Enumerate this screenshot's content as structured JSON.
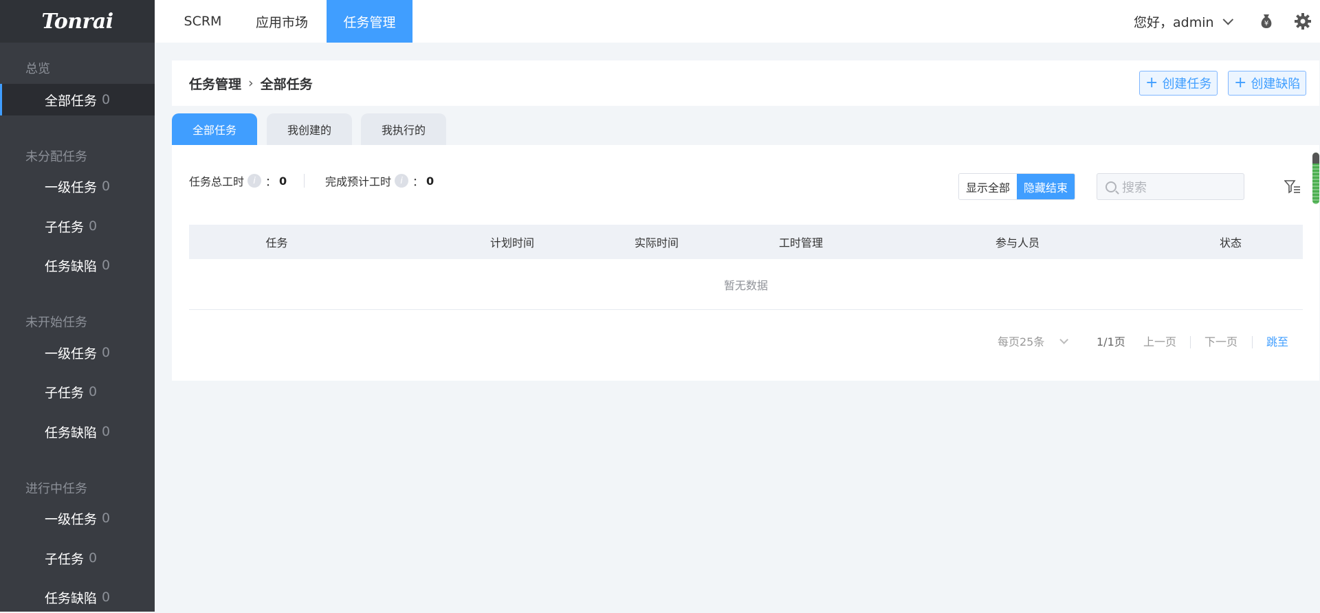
{
  "logo": "Tonrai",
  "sidebar": {
    "groups": [
      {
        "title": "总览",
        "items": [
          {
            "label": "全部任务",
            "count": "0"
          }
        ]
      },
      {
        "title": "未分配任务",
        "items": [
          {
            "label": "一级任务",
            "count": "0"
          },
          {
            "label": "子任务",
            "count": "0"
          },
          {
            "label": "任务缺陷",
            "count": "0"
          }
        ]
      },
      {
        "title": "未开始任务",
        "items": [
          {
            "label": "一级任务",
            "count": "0"
          },
          {
            "label": "子任务",
            "count": "0"
          },
          {
            "label": "任务缺陷",
            "count": "0"
          }
        ]
      },
      {
        "title": "进行中任务",
        "items": [
          {
            "label": "一级任务",
            "count": "0"
          },
          {
            "label": "子任务",
            "count": "0"
          },
          {
            "label": "任务缺陷",
            "count": "0"
          }
        ]
      }
    ]
  },
  "topnav": {
    "tabs": [
      {
        "label": "SCRM"
      },
      {
        "label": "应用市场"
      },
      {
        "label": "任务管理"
      }
    ],
    "greeting": "您好，admin"
  },
  "header": {
    "breadcrumb": [
      "任务管理",
      "全部任务"
    ],
    "create_task": "创建任务",
    "create_defect": "创建缺陷"
  },
  "subtabs": [
    {
      "label": "全部任务"
    },
    {
      "label": "我创建的"
    },
    {
      "label": "我执行的"
    }
  ],
  "stats": {
    "total_label": "任务总工时",
    "total_value": "0",
    "estimate_label": "完成预计工时",
    "estimate_value": "0",
    "colon": "："
  },
  "toggle": {
    "show_all": "显示全部",
    "hide_done": "隐藏结束"
  },
  "search": {
    "placeholder": "搜索"
  },
  "table": {
    "columns": [
      "任务",
      "计划时间",
      "实际时间",
      "工时管理",
      "参与人员",
      "状态"
    ],
    "empty_text": "暂无数据"
  },
  "pager": {
    "page_size": "每页25条",
    "page_info": "1/1页",
    "prev": "上一页",
    "next": "下一页",
    "jump": "跳至"
  },
  "colors": {
    "accent": "#409eff",
    "sidebar_bg": "#393c42"
  }
}
